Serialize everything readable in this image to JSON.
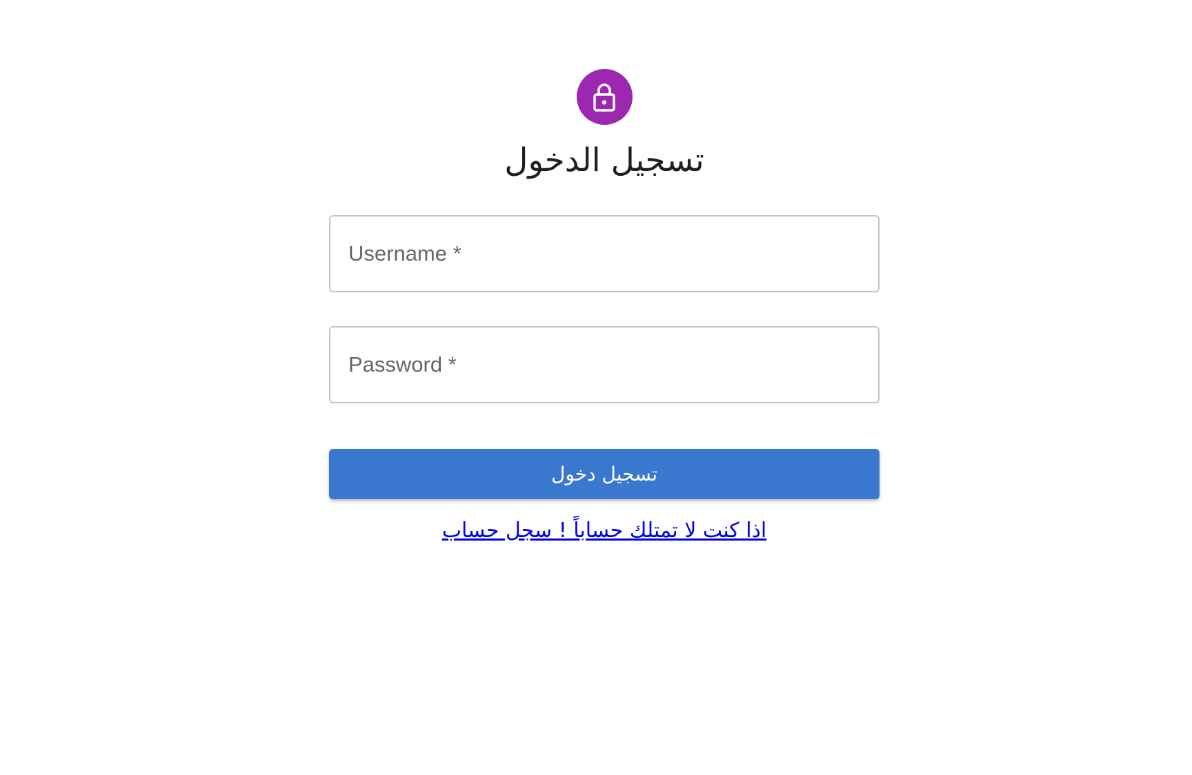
{
  "form": {
    "title": "تسجيل الدخول",
    "username_label": "Username *",
    "password_label": "Password *",
    "submit_label": "تسجيل دخول",
    "register_link": "اذا كنت لا تمتلك حساباً ! سجل حساب"
  },
  "icons": {
    "avatar": "lock-icon"
  },
  "colors": {
    "avatar_bg": "#9c27b0",
    "button_bg": "#3a78d0",
    "link": "#0000ee"
  }
}
